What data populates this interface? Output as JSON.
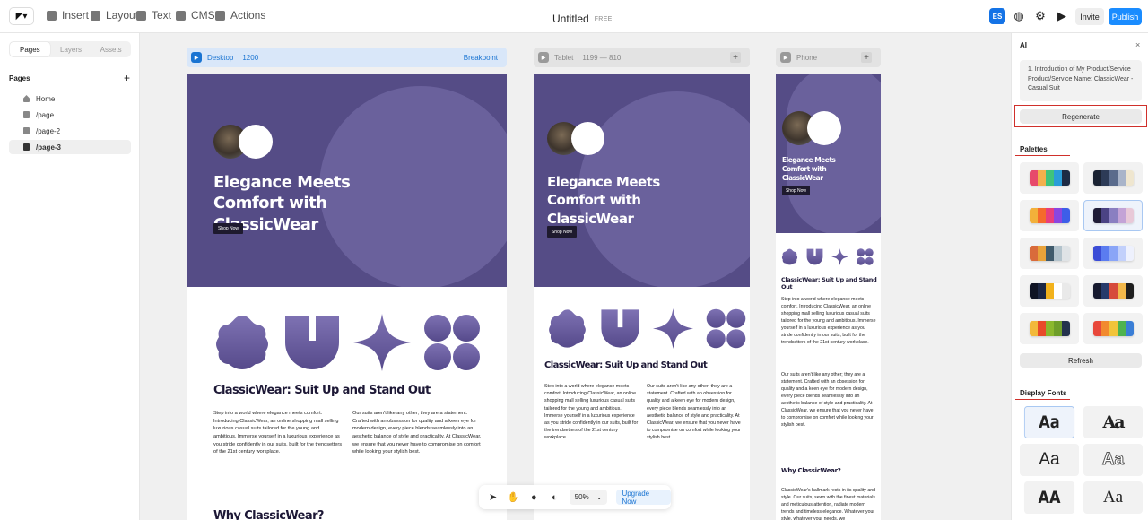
{
  "topbar": {
    "tools": [
      {
        "label": "Insert",
        "icon": "plus-square-icon"
      },
      {
        "label": "Layout",
        "icon": "layout-icon"
      },
      {
        "label": "Text",
        "icon": "text-icon"
      },
      {
        "label": "CMS",
        "icon": "database-icon"
      },
      {
        "label": "Actions",
        "icon": "actions-icon"
      }
    ],
    "doc_title": "Untitled",
    "plan_badge": "FREE",
    "avatar_initials": "ES",
    "invite_label": "Invite",
    "publish_label": "Publish",
    "accent": "#1a8cff"
  },
  "leftpanel": {
    "tabs": [
      "Pages",
      "Layers",
      "Assets"
    ],
    "heading": "Pages",
    "add_symbol": "+",
    "pages": [
      "Home",
      "/page",
      "/page-2",
      "/page-3"
    ]
  },
  "canvas": {
    "desktop": {
      "name": "Desktop",
      "width": "1200",
      "extra": "Breakpoint"
    },
    "tablet": {
      "name": "Tablet",
      "range": "1199 — 810"
    },
    "phone": {
      "name": "Phone"
    }
  },
  "site": {
    "hero_title": "Elegance Meets Comfort with ClassicWear",
    "shop_button": "Shop Now",
    "section_title": "ClassicWear: Suit Up and Stand Out",
    "para1": "Step into a world where elegance meets comfort. Introducing ClassicWear, an online shopping mall selling luxurious casual suits tailored for the young and ambitious. Immerse yourself in a luxurious experience as you stride confidently in our suits, built for the trendsetters of the 21st century workplace.",
    "para2": "Our suits aren't like any other; they are a statement. Crafted with an obsession for quality and a keen eye for modern design, every piece blends seamlessly into an aesthetic balance of style and practicality. At ClassicWear, we ensure that you never have to compromise on comfort while looking your stylish best.",
    "why_title": "Why ClassicWear?",
    "why_para": "ClassicWear's hallmark rests in its quality and style. Our suits, sewn with the finest materials and meticulous attention, radiate modern trends and timeless elegance. Whatever your style, whatever your needs, we",
    "hero_color": "#554c86"
  },
  "floating_toolbar": {
    "zoom": "50%",
    "upgrade_label": "Upgrade Now"
  },
  "ai_panel": {
    "title": "AI",
    "close_symbol": "×",
    "prompt_text": "1. Introduction of My Product/Service Product/Service Name: ClassicWear - Casual Suit",
    "regenerate_label": "Regenerate",
    "palettes_heading": "Palettes",
    "refresh_label": "Refresh",
    "fonts_heading": "Display Fonts",
    "font_sample": "Aa",
    "palettes": [
      [
        "#e74a6b",
        "#f2b04c",
        "#3fc37b",
        "#2a9dd8",
        "#1d2b45"
      ],
      [
        "#1b2333",
        "#2d3b57",
        "#5a6b8c",
        "#a9b4c9",
        "#efe6cf"
      ],
      [
        "#f2b03a",
        "#f56a2b",
        "#e83e7c",
        "#8a46e0",
        "#3d5ee8"
      ],
      [
        "#1f1d38",
        "#4b4384",
        "#8a7fc1",
        "#c3a3d6",
        "#e8c9d8"
      ],
      [
        "#d96b3b",
        "#e8a23a",
        "#3f5a6b",
        "#b3c3cc",
        "#dfe3e6"
      ],
      [
        "#3b4cd6",
        "#5b7cf0",
        "#8aa5f7",
        "#c2d0fb",
        "#eef1fd"
      ],
      [
        "#0f1424",
        "#1c2743",
        "#f2b21c",
        "#ffffff",
        "#e9e9e9"
      ],
      [
        "#161a2f",
        "#263a6b",
        "#d64a3b",
        "#f2b84b",
        "#1e1e1e"
      ],
      [
        "#f2b93b",
        "#e84b2a",
        "#8ab82e",
        "#6e9e2a",
        "#23324d"
      ],
      [
        "#e8483b",
        "#f28a2e",
        "#f2c43a",
        "#4fb34f",
        "#3a7ed6"
      ]
    ],
    "selected_palette": 3
  }
}
